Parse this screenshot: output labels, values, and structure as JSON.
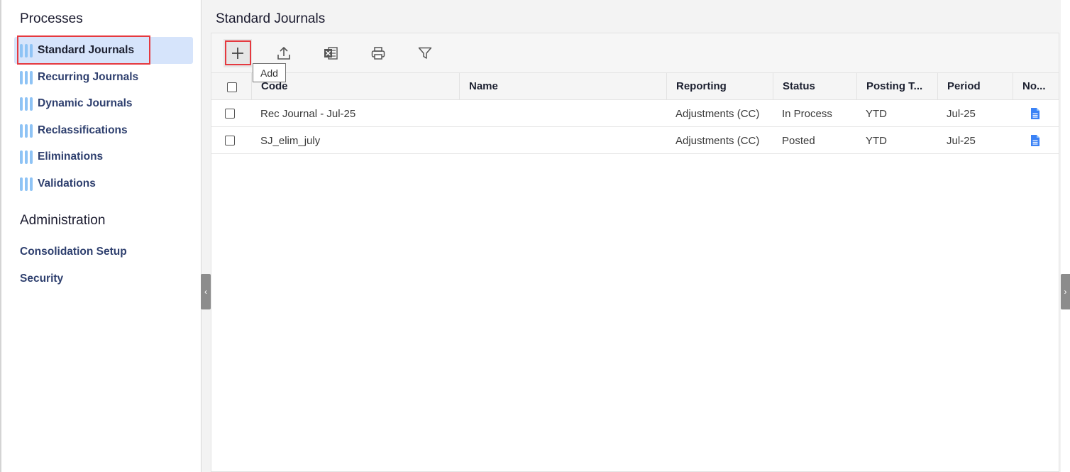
{
  "sidebar": {
    "processes_title": "Processes",
    "items": [
      {
        "label": "Standard Journals",
        "active": true
      },
      {
        "label": "Recurring Journals"
      },
      {
        "label": "Dynamic Journals"
      },
      {
        "label": "Reclassifications"
      },
      {
        "label": "Eliminations"
      },
      {
        "label": "Validations"
      }
    ],
    "admin_title": "Administration",
    "admin_items": [
      {
        "label": "Consolidation Setup"
      },
      {
        "label": "Security"
      }
    ]
  },
  "main": {
    "title": "Standard Journals",
    "toolbar": {
      "icons": [
        "add-icon",
        "upload-icon",
        "excel-icon",
        "print-icon",
        "filter-icon"
      ],
      "tooltip": "Add"
    },
    "table": {
      "columns": [
        "Code",
        "Name",
        "Reporting",
        "Status",
        "Posting T...",
        "Period",
        "No..."
      ],
      "rows": [
        {
          "code": "Rec Journal - Jul-25",
          "name": "",
          "reporting": "Adjustments (CC)",
          "status": "In Process",
          "posting": "YTD",
          "period": "Jul-25"
        },
        {
          "code": "SJ_elim_july",
          "name": "",
          "reporting": "Adjustments (CC)",
          "status": "Posted",
          "posting": "YTD",
          "period": "Jul-25"
        }
      ]
    }
  },
  "colors": {
    "accent": "#8ec3f5",
    "active_bg": "#d6e4fb",
    "highlight_outline": "#e5393f",
    "nav_text": "#2e3f6e",
    "doc_icon": "#3b82f6"
  }
}
